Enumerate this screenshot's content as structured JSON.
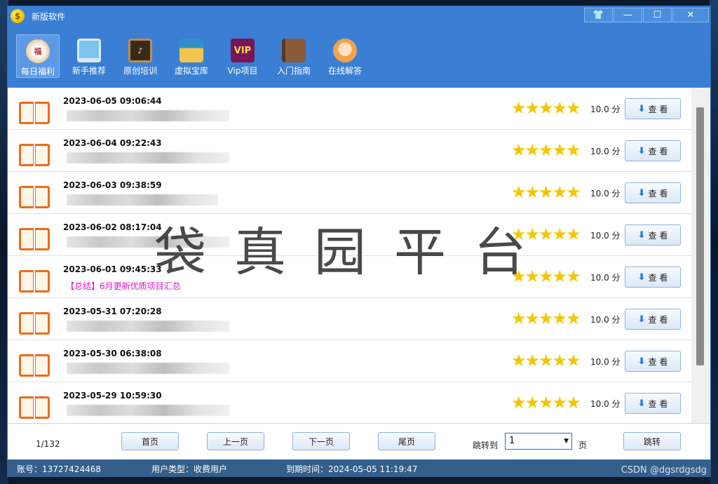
{
  "window": {
    "title": "新版软件",
    "controls": [
      "shirt-icon",
      "minimize-icon",
      "maximize-icon",
      "close-icon"
    ]
  },
  "toolbar": {
    "items": [
      {
        "label": "每日福利",
        "icon": "lucky-cat-icon",
        "active": true
      },
      {
        "label": "新手推荐",
        "icon": "laptop-icon"
      },
      {
        "label": "原创培训",
        "icon": "chalkboard-icon"
      },
      {
        "label": "虚拟宝库",
        "icon": "treasure-box-icon"
      },
      {
        "label": "Vip项目",
        "icon": "vip-icon",
        "icon_text": "VIP"
      },
      {
        "label": "入门指南",
        "icon": "book-icon"
      },
      {
        "label": "在线解答",
        "icon": "support-agent-icon"
      }
    ]
  },
  "list": {
    "rows": [
      {
        "date": "2023-06-05 09:06:44",
        "title": "",
        "score": "10.0 分",
        "view_label": "查 看",
        "stars": 5
      },
      {
        "date": "2023-06-04 09:22:43",
        "title": "",
        "score": "10.0 分",
        "view_label": "查 看",
        "stars": 5
      },
      {
        "date": "2023-06-03 09:38:59",
        "title": "",
        "score": "10.0 分",
        "view_label": "查 看",
        "stars": 5
      },
      {
        "date": "2023-06-02 08:17:04",
        "title": "",
        "score": "10.0 分",
        "view_label": "查 看",
        "stars": 5
      },
      {
        "date": "2023-06-01 09:45:33",
        "title": "【总结】6月更新优质项目汇总",
        "score": "10.0 分",
        "view_label": "查 看",
        "stars": 5
      },
      {
        "date": "2023-05-31 07:20:28",
        "title": "",
        "score": "10.0 分",
        "view_label": "查 看",
        "stars": 5
      },
      {
        "date": "2023-05-30 06:38:08",
        "title": "",
        "score": "10.0 分",
        "view_label": "查 看",
        "stars": 5
      },
      {
        "date": "2023-05-29 10:59:30",
        "title": "",
        "score": "10.0 分",
        "view_label": "查 看",
        "stars": 5
      }
    ],
    "stars_glyph": "★★★★★",
    "title_color": "#e010c8"
  },
  "watermark": "袋真园平台",
  "pager": {
    "page_info": "1/132",
    "first": "首页",
    "prev": "上一页",
    "next": "下一页",
    "last": "尾页",
    "jump_label": "跳转到",
    "jump_value": "1",
    "page_unit": "页",
    "jump_button": "跳转"
  },
  "status": {
    "account": "账号：13727424468",
    "user_type": "用户类型：收费用户",
    "expiry": "到期时间：2024-05-05 11:19:47"
  },
  "credit": "CSDN @dgsrdgsdg",
  "colors": {
    "titlebar": "#3a7fd4",
    "accent": "#2f6fc2",
    "star": "#f5c600",
    "book": "#ef6a1a"
  }
}
